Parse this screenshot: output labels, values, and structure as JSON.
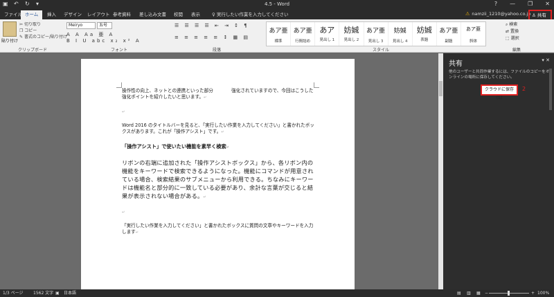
{
  "window": {
    "title": "4.5 - Word",
    "buttons": [
      "?",
      "—",
      "❐",
      "✕"
    ]
  },
  "tabs": [
    {
      "label": "ファイル"
    },
    {
      "label": "ホーム"
    },
    {
      "label": "挿入"
    },
    {
      "label": "デザイン"
    },
    {
      "label": "レイアウト"
    },
    {
      "label": "参考資料"
    },
    {
      "label": "差し込み文書"
    },
    {
      "label": "校閲"
    },
    {
      "label": "表示"
    }
  ],
  "tell_me": "実行したい作業を入力してください",
  "account": "namzii_1210@yahoo.co.jp",
  "share_button": "共有",
  "annotations": {
    "one": "1",
    "two": "2"
  },
  "clipboard": {
    "paste": "貼り付け",
    "cut": "切り取り",
    "copy": "コピー",
    "format_painter": "書式のコピー/貼り付け",
    "group": "クリップボード"
  },
  "font": {
    "name": "Meiryo",
    "size": "五号",
    "row1": "A A Aa 亜 A",
    "row2": "B I U abc x₂ x² A",
    "group": "フォント"
  },
  "paragraph": {
    "row1": "☰ ☰ ☰ ☰ ⇤ ⇥ ↕ ¶",
    "row2": "≡ ≡ ≡ ≡ ≡ ↕ ▦ ▤",
    "group": "段落"
  },
  "styles": {
    "items": [
      {
        "sample": "あア亜",
        "name": "標準"
      },
      {
        "sample": "あア亜",
        "name": "行間詰め"
      },
      {
        "sample": "あア",
        "name": "見出し 1"
      },
      {
        "sample": "妨娍",
        "name": "見出し 2"
      },
      {
        "sample": "あア亜",
        "name": "見出し 3"
      },
      {
        "sample": "妨娍",
        "name": "見出し 4"
      },
      {
        "sample": "妨娍",
        "name": "表題"
      },
      {
        "sample": "あア亜",
        "name": "副題"
      },
      {
        "sample": "あア亜",
        "name": "斜体"
      }
    ],
    "group": "スタイル"
  },
  "editing": {
    "find": "検索",
    "replace": "置換",
    "select": "選択",
    "group": "編集"
  },
  "document": {
    "paragraphs": [
      {
        "text": "操作性の向上、ネットとの連携といった部分　　　　強化されていますので、今回はこうした強化ポイントを紹介したいと思います。",
        "style": "normal"
      },
      {
        "text": "",
        "style": "empty"
      },
      {
        "text": "Word 2016 のタイトルバーを見ると、「実行したい作業を入力してください」と書かれたボックスがあります。これが「操作アシスト」です。",
        "style": "normal"
      },
      {
        "text": "「操作アシスト」で使いたい機能を素早く検索",
        "style": "bold"
      },
      {
        "text": "リボンの右端に追加された「操作アシストボックス」から、各リボン内の機能をキーワードで検索できるようになった。機能にコマンドが用意されている場合、検索結果のサブメニューから利用できる。ちなみにキーワードは機能名と部分的に一致している必要があり、余計な言葉が交じると結果が表示されない場合がある。",
        "style": "big"
      },
      {
        "text": "",
        "style": "empty"
      },
      {
        "text": "「実行したい作業を入力してください」と書かれたボックスに質問の文章やキーワードを入力します",
        "style": "normal"
      }
    ]
  },
  "share_pane": {
    "title": "共有",
    "description": "他のユーザーと共同作業するには、ファイルのコピーをオンラインの場所に保存してください。",
    "save_button": "クラウドに保存(S)"
  },
  "status": {
    "page": "1/3 ページ",
    "words": "1562 文字",
    "language": "日本語",
    "zoom": "100%",
    "zoom_fraction": 0.5
  }
}
